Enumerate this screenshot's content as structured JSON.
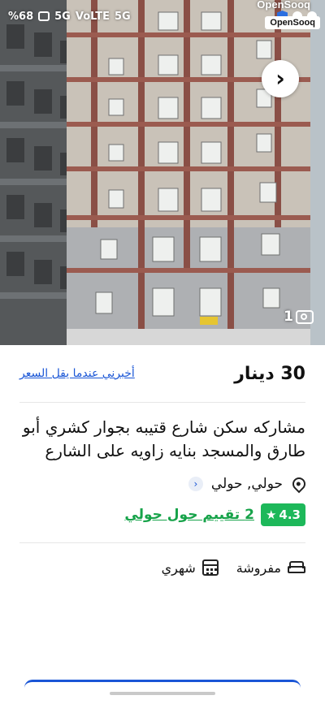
{
  "status_bar": {
    "battery": "%68",
    "network_labels": [
      "5G",
      "VoLTE",
      "5G"
    ],
    "icons": [
      "battery-icon",
      "signal-icon",
      "wifi-icon",
      "shield-icon",
      "whatsapp-icon",
      "messenger-icon"
    ]
  },
  "brand": {
    "name": "OpenSooq",
    "overlay_name": "OpenSooq"
  },
  "gallery": {
    "photo_count": "1",
    "next_icon": "chevron-right-icon",
    "camera_icon": "camera-icon"
  },
  "listing": {
    "price": "30 دينار",
    "price_alert_link": "أخبرني عندما يقل السعر",
    "title": "مشاركه سكن شارع قتيبه بجوار كشري أبو طارق والمسجد بنايه زاويه على الشارع",
    "location": "حولي, حولي",
    "rating": {
      "value": "4.3",
      "reviews_link": "2 تقييم حول حولي"
    },
    "specs": [
      {
        "label": "مفروشة",
        "icon": "sofa-icon"
      },
      {
        "label": "شهري",
        "icon": "calendar-icon"
      }
    ]
  },
  "colors": {
    "link_blue": "#1a56d6",
    "rating_green": "#1db85a"
  }
}
